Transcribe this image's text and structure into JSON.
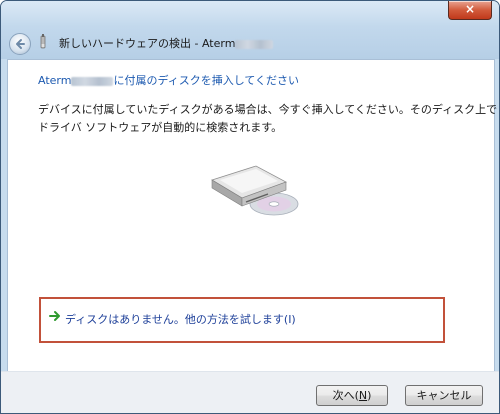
{
  "window": {
    "title_prefix": "新しいハードウェアの検出 - Aterm",
    "close_glyph": "×"
  },
  "content": {
    "heading_prefix": "Aterm",
    "heading_suffix": "に付属のディスクを挿入してください",
    "description_line1": "デバイスに付属していたディスクがある場合は、今すぐ挿入してください。そのディスク上で",
    "description_line2": "ドライバ ソフトウェアが自動的に検索されます。",
    "option_label": "ディスクはありません。他の方法を試します(I)"
  },
  "footer": {
    "next_prefix": "次へ(",
    "next_mnemonic": "N",
    "next_suffix": ")",
    "cancel_label": "キャンセル"
  },
  "colors": {
    "heading": "#1d5ab0",
    "option_border": "#c2513a",
    "option_arrow": "#2f9a2f"
  },
  "icons": {
    "back": "back-arrow-icon",
    "device": "device-icon",
    "illustration": "disk-drive-icon",
    "option": "green-arrow-icon"
  }
}
